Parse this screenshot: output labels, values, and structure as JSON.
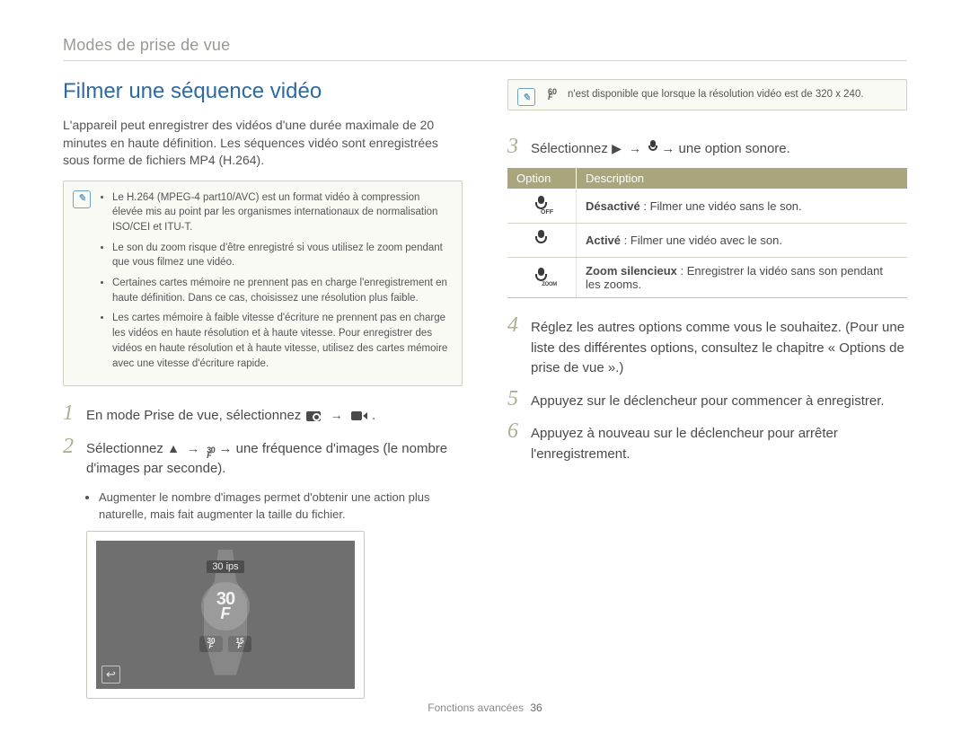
{
  "breadcrumb": "Modes de prise de vue",
  "title": "Filmer une séquence vidéo",
  "intro": "L'appareil peut enregistrer des vidéos d'une durée maximale de 20 minutes en haute définition. Les séquences vidéo sont enregistrées sous forme de fichiers MP4 (H.264).",
  "info_bullets": [
    "Le H.264 (MPEG-4 part10/AVC) est un format vidéo à compression élevée mis au point par les organismes internationaux de normalisation ISO/CEI et ITU-T.",
    "Le son du zoom risque d'être enregistré si vous utilisez le zoom pendant que vous filmez une vidéo.",
    "Certaines cartes mémoire ne prennent pas en charge l'enregistrement en haute définition. Dans ce cas, choisissez une résolution plus faible.",
    "Les cartes mémoire à faible vitesse d'écriture ne prennent pas en charge les vidéos en haute résolution et à haute vitesse. Pour enregistrer des vidéos en haute résolution et à haute vitesse, utilisez des cartes mémoire avec une vitesse d'écriture rapide."
  ],
  "steps_left": {
    "1": {
      "pre": "En mode Prise de vue, sélectionnez ",
      "post": "."
    },
    "2": {
      "pre": "Sélectionnez ",
      "mid": " → une fréquence d'images (le nombre d'images par seconde)."
    }
  },
  "sub_bullet": "Augmenter le nombre d'images permet d'obtenir une action plus naturelle, mais fait augmenter la taille du fichier.",
  "lcd": {
    "tip": "30 ips",
    "big": "30",
    "bigF": "F",
    "chip1top": "30",
    "chip1bot": "F",
    "chip2top": "15",
    "chip2bot": "F",
    "back": "↩"
  },
  "sixty_note": {
    "emblem_top": "60",
    "emblem_bot": "F",
    "text": "n'est disponible que lorsque la résolution vidéo est de 320 x 240."
  },
  "steps_right": {
    "3": {
      "pre": "Sélectionnez ",
      "mid": " → une option sonore."
    },
    "4": "Réglez les autres options comme vous le souhaitez. (Pour une liste des différentes options, consultez le chapitre « Options de prise de vue ».)",
    "5": "Appuyez sur le déclencheur pour commencer à enregistrer.",
    "6": "Appuyez à nouveau sur le déclencheur pour arrêter l'enregistrement."
  },
  "table": {
    "head_opt": "Option",
    "head_desc": "Description",
    "rows": [
      {
        "icon": "mic-off",
        "sub": "OFF",
        "bold": "Désactivé",
        "sep": " : ",
        "text": "Filmer une vidéo sans le son."
      },
      {
        "icon": "mic-on",
        "sub": "",
        "bold": "Activé",
        "sep": " : ",
        "text": "Filmer une vidéo avec le son."
      },
      {
        "icon": "mic-zoom",
        "sub": "ZOOM",
        "bold": "Zoom silencieux",
        "sep": " : ",
        "text": "Enregistrer la vidéo sans son pendant les zooms."
      }
    ]
  },
  "footer": {
    "section": "Fonctions avancées",
    "page": "36"
  }
}
